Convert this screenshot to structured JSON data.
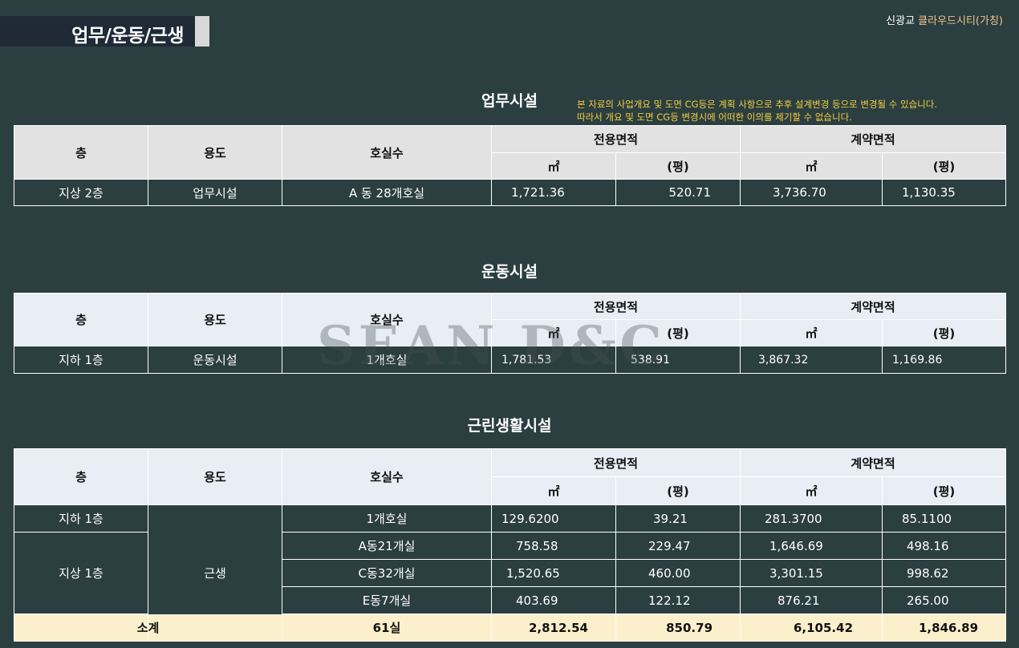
{
  "header": {
    "title": "업무/운동/근생",
    "brand_prefix": "신광교 ",
    "brand_name": "클라우드시티(가칭)"
  },
  "notice": {
    "line1": "본 자료의 사업개요 및 도면 CG등은 계획 사항으로 추후 설계변경 등으로 변경될 수 있습니다.",
    "line2": "따라서 개요 및 도면 CG등 변경시에 어떠한 이의를 제기할 수 없습니다."
  },
  "columns": {
    "floor": "층",
    "use": "용도",
    "rooms": "호실수",
    "exclusive_area": "전용면적",
    "contract_area": "계약면적",
    "sqm": "㎡",
    "pyeong": "(평)"
  },
  "office": {
    "title": "업무시설",
    "rows": [
      {
        "floor": "지상 2층",
        "use": "업무시설",
        "rooms": "A 동 28개호실",
        "ex_sqm": "1,721.36",
        "ex_py": "520.71",
        "ct_sqm": "3,736.70",
        "ct_py": "1,130.35"
      }
    ]
  },
  "sports": {
    "title": "운동시설",
    "rows": [
      {
        "floor": "지하 1층",
        "use": "운동시설",
        "rooms": "1개호실",
        "ex_sqm": "1,781.53",
        "ex_py": "538.91",
        "ct_sqm": "3,867.32",
        "ct_py": "1,169.86"
      }
    ]
  },
  "retail": {
    "title": "근린생활시설",
    "use": "근생",
    "floors": [
      "지하 1층",
      "지상 1층"
    ],
    "rows": [
      {
        "rooms": "1개호실",
        "ex_sqm": "129.6200",
        "ex_py": "39.21",
        "ct_sqm": "281.3700",
        "ct_py": "85.1100"
      },
      {
        "rooms": "A동21개실",
        "ex_sqm": "758.58",
        "ex_py": "229.47",
        "ct_sqm": "1,646.69",
        "ct_py": "498.16"
      },
      {
        "rooms": "C동32개실",
        "ex_sqm": "1,520.65",
        "ex_py": "460.00",
        "ct_sqm": "3,301.15",
        "ct_py": "998.62"
      },
      {
        "rooms": "E동7개실",
        "ex_sqm": "403.69",
        "ex_py": "122.12",
        "ct_sqm": "876.21",
        "ct_py": "265.00"
      }
    ],
    "total": {
      "label": "소계",
      "rooms": "61실",
      "ex_sqm": "2,812.54",
      "ex_py": "850.79",
      "ct_sqm": "6,105.42",
      "ct_py": "1,846.89"
    }
  },
  "watermark": "SEAN D&C"
}
